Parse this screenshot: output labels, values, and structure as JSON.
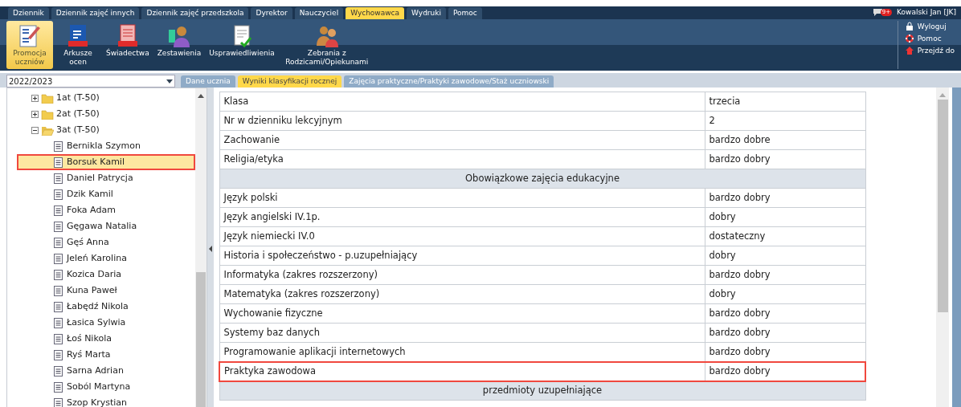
{
  "top_tabs": [
    {
      "label": "Dziennik",
      "selected": false
    },
    {
      "label": "Dziennik zajęć innych",
      "selected": false
    },
    {
      "label": "Dziennik zajęć przedszkola",
      "selected": false
    },
    {
      "label": "Dyrektor",
      "selected": false
    },
    {
      "label": "Nauczyciel",
      "selected": false
    },
    {
      "label": "Wychowawca",
      "selected": true
    },
    {
      "label": "Wydruki",
      "selected": false
    },
    {
      "label": "Pomoc",
      "selected": false
    }
  ],
  "user": {
    "badge": "9+",
    "name": "Kowalski Jan [JK]"
  },
  "toolbar": [
    {
      "label": "Promocja uczniów",
      "kind": "promotion",
      "selected": true
    },
    {
      "label": "Arkusze ocen",
      "kind": "pdf-grade",
      "selected": false
    },
    {
      "label": "Świadectwa",
      "kind": "pdf-cert",
      "selected": false
    },
    {
      "label": "Zestawienia",
      "kind": "person-chart",
      "selected": false
    },
    {
      "label": "Usprawiedliwienia",
      "kind": "doc-check",
      "selected": false
    },
    {
      "label": "Zebrania z Rodzicami/Opiekunami",
      "kind": "people",
      "selected": false
    }
  ],
  "side_menu": [
    {
      "label": "Wyloguj",
      "kind": "lock"
    },
    {
      "label": "Pomoc",
      "kind": "lifebuoy"
    },
    {
      "label": "Przejdź do",
      "kind": "home"
    }
  ],
  "year_select": {
    "value": "2022/2023"
  },
  "content_tabs": [
    {
      "label": "Dane ucznia",
      "selected": false
    },
    {
      "label": "Wyniki klasyfikacji rocznej",
      "selected": true
    },
    {
      "label": "Zajęcia praktyczne/Praktyki zawodowe/Staż uczniowski",
      "selected": false
    }
  ],
  "tree": [
    {
      "label": "1at (T-50)",
      "expanded": false
    },
    {
      "label": "2at (T-50)",
      "expanded": false
    },
    {
      "label": "3at (T-50)",
      "expanded": true,
      "children": [
        {
          "label": "Bernikla Szymon",
          "selected": false
        },
        {
          "label": "Borsuk Kamil",
          "selected": true
        },
        {
          "label": "Daniel Patrycja",
          "selected": false
        },
        {
          "label": "Dzik Kamil",
          "selected": false
        },
        {
          "label": "Foka Adam",
          "selected": false
        },
        {
          "label": "Gęgawa Natalia",
          "selected": false
        },
        {
          "label": "Gęś Anna",
          "selected": false
        },
        {
          "label": "Jeleń Karolina",
          "selected": false
        },
        {
          "label": "Kozica Daria",
          "selected": false
        },
        {
          "label": "Kuna Paweł",
          "selected": false
        },
        {
          "label": "Łabędź Nikola",
          "selected": false
        },
        {
          "label": "Łasica Sylwia",
          "selected": false
        },
        {
          "label": "Łoś Nikola",
          "selected": false
        },
        {
          "label": "Ryś Marta",
          "selected": false
        },
        {
          "label": "Sarna Adrian",
          "selected": false
        },
        {
          "label": "Soból Martyna",
          "selected": false
        },
        {
          "label": "Szop Krystian",
          "selected": false
        }
      ]
    }
  ],
  "table": {
    "rows": [
      {
        "kind": "row",
        "label": "Klasa",
        "value": "trzecia",
        "highlighted": false
      },
      {
        "kind": "row",
        "label": "Nr w dzienniku lekcyjnym",
        "value": "2",
        "highlighted": false
      },
      {
        "kind": "row",
        "label": "Zachowanie",
        "value": "bardzo dobre",
        "highlighted": false
      },
      {
        "kind": "row",
        "label": "Religia/etyka",
        "value": "bardzo dobry",
        "highlighted": false
      },
      {
        "kind": "section",
        "label": "Obowiązkowe zajęcia edukacyjne"
      },
      {
        "kind": "row",
        "label": "Język polski",
        "value": "bardzo dobry",
        "highlighted": false
      },
      {
        "kind": "row",
        "label": "Język angielski IV.1p.",
        "value": "dobry",
        "highlighted": false
      },
      {
        "kind": "row",
        "label": "Język niemiecki IV.0",
        "value": "dostateczny",
        "highlighted": false
      },
      {
        "kind": "row",
        "label": "Historia i społeczeństwo - p.uzupełniający",
        "value": "dobry",
        "highlighted": false
      },
      {
        "kind": "row",
        "label": "Informatyka (zakres rozszerzony)",
        "value": "bardzo dobry",
        "highlighted": false
      },
      {
        "kind": "row",
        "label": "Matematyka (zakres rozszerzony)",
        "value": "dobry",
        "highlighted": false
      },
      {
        "kind": "row",
        "label": "Wychowanie fizyczne",
        "value": "bardzo dobry",
        "highlighted": false
      },
      {
        "kind": "row",
        "label": "Systemy baz danych",
        "value": "bardzo dobry",
        "highlighted": false
      },
      {
        "kind": "row",
        "label": "Programowanie aplikacji internetowych",
        "value": "bardzo dobry",
        "highlighted": false
      },
      {
        "kind": "row",
        "label": "Praktyka zawodowa",
        "value": "bardzo dobry",
        "highlighted": true
      },
      {
        "kind": "section",
        "label": "przedmioty uzupełniające"
      }
    ]
  }
}
